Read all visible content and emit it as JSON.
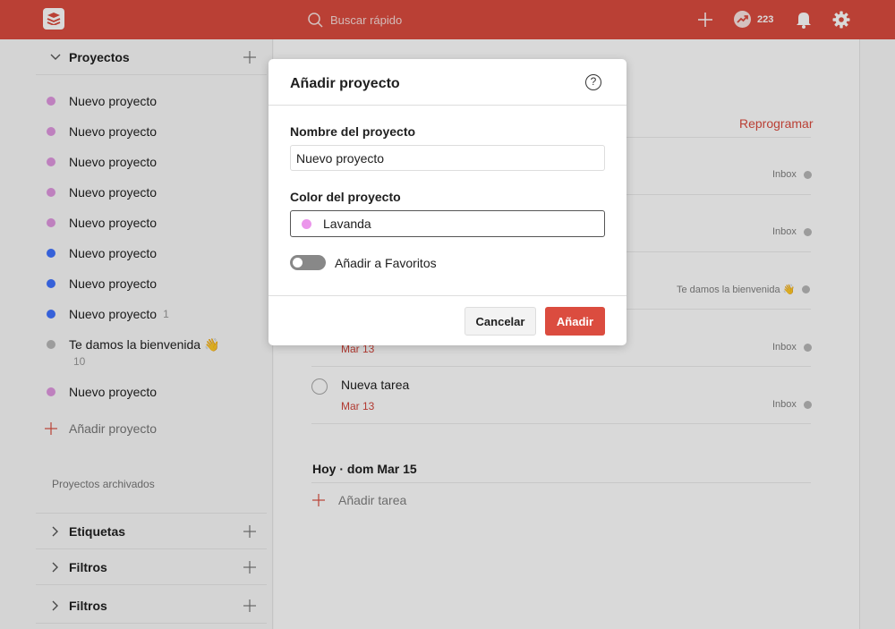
{
  "topbar": {
    "search_placeholder": "Buscar rápido",
    "karma_count": "223",
    "accent_color": "#db4c3f"
  },
  "sidebar": {
    "projects_title": "Proyectos",
    "projects": [
      {
        "name": "Nuevo proyecto",
        "color": "#e097e0",
        "count": ""
      },
      {
        "name": "Nuevo proyecto",
        "color": "#e097e0",
        "count": ""
      },
      {
        "name": "Nuevo proyecto",
        "color": "#e097e0",
        "count": ""
      },
      {
        "name": "Nuevo proyecto",
        "color": "#e097e0",
        "count": ""
      },
      {
        "name": "Nuevo proyecto",
        "color": "#e097e0",
        "count": ""
      },
      {
        "name": "Nuevo proyecto",
        "color": "#4073ff",
        "count": ""
      },
      {
        "name": "Nuevo proyecto",
        "color": "#4073ff",
        "count": ""
      },
      {
        "name": "Nuevo proyecto",
        "color": "#4073ff",
        "count": "1"
      },
      {
        "name": "Te damos la bienvenida 👋",
        "color": "#b8b8b8",
        "count": "",
        "sub": "10"
      },
      {
        "name": "Nuevo proyecto",
        "color": "#e097e0",
        "count": ""
      }
    ],
    "add_project": "Añadir proyecto",
    "archived": "Proyectos archivados",
    "labels_title": "Etiquetas",
    "filters_title": "Filtros",
    "filters_title_2": "Filtros"
  },
  "main": {
    "reschedule": "Reprogramar",
    "tasks": [
      {
        "project": "Inbox"
      },
      {
        "project": "Inbox"
      },
      {
        "project": "Te damos la bienvenida 👋"
      },
      {
        "project": "Inbox",
        "date": "Mar 13"
      },
      {
        "title": "Nueva tarea",
        "project": "Inbox",
        "date": "Mar 13"
      }
    ],
    "today_heading": "Hoy · dom Mar 15",
    "add_task": "Añadir tarea"
  },
  "modal": {
    "title": "Añadir proyecto",
    "help_glyph": "?",
    "name_label": "Nombre del proyecto",
    "name_value": "Nuevo proyecto",
    "color_label": "Color del proyecto",
    "color_value": "Lavanda",
    "color_hex": "#eb96eb",
    "favorites_label": "Añadir a Favoritos",
    "favorites_on": false,
    "cancel_label": "Cancelar",
    "add_label": "Añadir"
  }
}
